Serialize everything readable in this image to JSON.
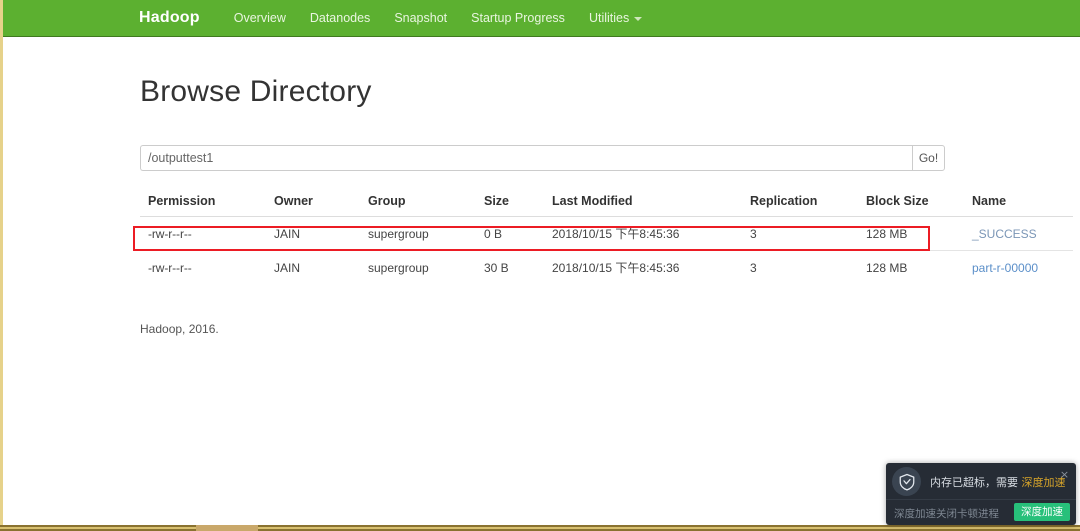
{
  "navbar": {
    "brand": "Hadoop",
    "links": [
      {
        "label": "Overview"
      },
      {
        "label": "Datanodes"
      },
      {
        "label": "Snapshot"
      },
      {
        "label": "Startup Progress"
      },
      {
        "label": "Utilities",
        "dropdown": true
      }
    ],
    "background_color": "#5cb030"
  },
  "page": {
    "title": "Browse Directory",
    "footer": "Hadoop, 2016."
  },
  "path_bar": {
    "value": "/outputtest1",
    "placeholder": "Enter a directory path",
    "go_label": "Go!"
  },
  "table": {
    "headers": [
      "Permission",
      "Owner",
      "Group",
      "Size",
      "Last Modified",
      "Replication",
      "Block Size",
      "Name"
    ],
    "rows": [
      {
        "permission": "-rw-r--r--",
        "owner": "JAIN",
        "group": "supergroup",
        "size": "0 B",
        "last_modified": "2018/10/15 下午8:45:36",
        "replication": "3",
        "block_size": "128 MB",
        "name": "_SUCCESS",
        "visited": true,
        "highlighted": false
      },
      {
        "permission": "-rw-r--r--",
        "owner": "JAIN",
        "group": "supergroup",
        "size": "30 B",
        "last_modified": "2018/10/15 下午8:45:36",
        "replication": "3",
        "block_size": "128 MB",
        "name": "part-r-00000",
        "visited": false,
        "highlighted": true
      }
    ],
    "highlight_color": "#ec1c24"
  },
  "toast": {
    "message_prefix": "内存已超标，需要 ",
    "message_highlight": "深度加速",
    "sub_text": "深度加速关闭卡顿进程",
    "button_label": "深度加速",
    "close_label": "×",
    "accent_color": "#27c07a",
    "highlight_color": "#d8a52a"
  }
}
